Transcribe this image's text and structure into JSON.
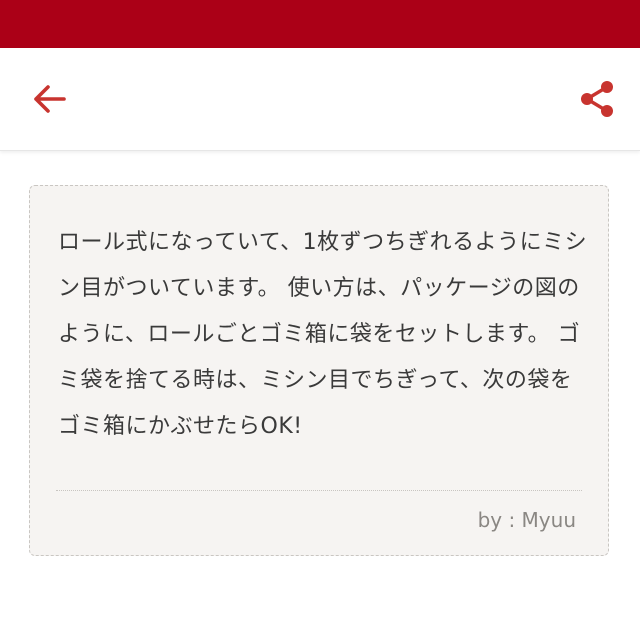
{
  "colors": {
    "status_bar": "#ab0017",
    "accent": "#c8342f",
    "card_background": "#f6f4f2",
    "text": "#3a3a3a",
    "muted_text": "#8a8783"
  },
  "toolbar": {
    "back_icon": "arrow-left-icon",
    "share_icon": "share-icon"
  },
  "comment": {
    "body": "ロール式になっていて、1枚ずつちぎれるようにミシン目がついています。 使い方は、パッケージの図のように、ロールごとゴミ箱に袋をセットします。 ゴミ袋を捨てる時は、ミシン目でちぎって、次の袋をゴミ箱にかぶせたらOK!",
    "author": "by : Myuu"
  }
}
